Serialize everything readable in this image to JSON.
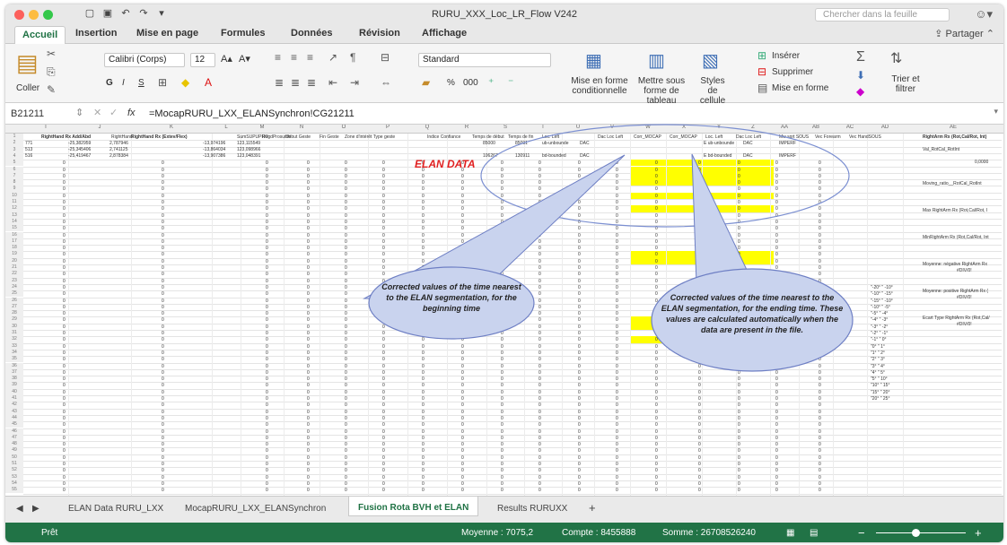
{
  "window": {
    "title": "RURU_XXX_Loc_LR_Flow V242",
    "search_placeholder": "Chercher dans la feuille"
  },
  "ribbon_tabs": [
    "Accueil",
    "Insertion",
    "Mise en page",
    "Formules",
    "Données",
    "Révision",
    "Affichage"
  ],
  "share_label": "Partager",
  "ribbon": {
    "paste_label": "Coller",
    "font_name": "Calibri (Corps)",
    "font_size": "12",
    "number_format": "Standard",
    "bold": "G",
    "italic": "I",
    "underline": "S",
    "percent": "%",
    "thousands": "000",
    "cond_format": "Mise en forme conditionnelle",
    "table_format": "Mettre sous forme de tableau",
    "cell_styles": "Styles de cellule",
    "insert": "Insérer",
    "delete": "Supprimer",
    "format": "Mise en forme",
    "sort_filter": "Trier et filtrer"
  },
  "formula_bar": {
    "cell_ref": "B21211",
    "fx": "fx",
    "formula": "=MocapRURU_LXX_ELANSynchron!CG21211"
  },
  "columns": [
    "I",
    "J",
    "K",
    "L",
    "M",
    "N",
    "O",
    "P",
    "Q",
    "R",
    "S",
    "T",
    "U",
    "V",
    "W",
    "X",
    "Y",
    "Z",
    "AA",
    "AB",
    "AC",
    "AD",
    "AE"
  ],
  "headers": {
    "c1": "RightHand Rx Add/Abd",
    "c2": "RightHand",
    "c3": "RightHand Rx (Extev/Flex)",
    "c4": "SumSUPUPRO",
    "c5": "RegdProsumb",
    "c6": "Début Geste",
    "c7": "Fin Geste",
    "c8": "Zone d'intérêt Type geste",
    "c9": "Indice Confiance",
    "c10": "Temps de début",
    "c11": "Temps de fin",
    "c12": "Loc. Left",
    "c13": "Dac Loc Left",
    "c14": "Corr_MOCAP",
    "c15": "Corr_MOCAP",
    "c16": "Loc. Left",
    "c17": "Dac Loc Left",
    "c18": "Mw sqrt SOUS",
    "c19": "Vec Forearm",
    "c20": "Vec HandSOUS",
    "c21": "RightArm Rx (Rot,Cal/Rot, Int)"
  },
  "rows": [
    [
      "771",
      "-25,382959",
      "2,787946",
      "-13,974196",
      "123,115549"
    ],
    [
      "513",
      "-25,345406",
      "2,741125",
      "-13,864034",
      "123,098966"
    ],
    [
      "516",
      "-25,419467",
      "2,878384",
      "-13,907386",
      "123,048391"
    ]
  ],
  "elan_values": [
    "85000",
    "85091",
    "ub-unbounde",
    "DAC",
    "E ub-unbounde",
    "DAC",
    "IMPERF"
  ],
  "elan_values2": [
    "106267",
    "130911",
    "bd-bounded",
    "DAC",
    "E bd-bounded",
    "DAC",
    "IMPERF"
  ],
  "side_labels": [
    "Val_RotCal_RotInt",
    "0,0000",
    "Moving_ratio__RotCal_RotInt",
    "Max RightArm Rx (Rot,Cal/Rot, I",
    "MinRightArm Rx (Rot,Cal/Rot, Int",
    "Moyenne: négative RightArm Rx",
    "#DIV/0!",
    "Moyenne: positive RightArm Rx (",
    "#DIV/0!",
    "Ecart Type RightArm Rx (Rot,Cal/",
    "#DIV/0!"
  ],
  "angle_list": [
    "\"-20° \" -10°",
    "\"-10° \" -15°",
    "\"-15° \" -10°",
    "\"-10° \" -5°",
    "\"-5° \" -4°",
    "\"-4° \" -3°",
    "\"-3° \" -2°",
    "\"-2° \" -1°",
    "\"-1° \" 0°",
    "\"0° \" 1°",
    "\"1° \" 2°",
    "\"2° \" 3°",
    "\"3° \" 4°",
    "\"4° \" 5°",
    "\"5° \" 10°",
    "\"10° \" 15°",
    "\"15° \" 20°",
    "\"20° \" 25°"
  ],
  "annotations": {
    "elan_data": "ELAN DATA",
    "left_bubble": "Corrected values of the time nearest to the ELAN segmentation, for the  beginning time",
    "right_bubble": "Corrected values of the time nearest to the ELAN segmentation, for the  ending time. These values are calculated automatically when the data are present in the file."
  },
  "sheet_tabs": [
    "ELAN Data RURU_LXX",
    "MocapRURU_LXX_ELANSynchron",
    "Fusion Rota BVH et ELAN",
    "Results RURUXX"
  ],
  "active_sheet": "Fusion Rota BVH et ELAN",
  "add_sheet": "+",
  "status": {
    "ready": "Prêt",
    "average": "Moyenne : 7075,2",
    "count": "Compte : 8455888",
    "sum": "Somme : 26708526240"
  },
  "colors": {
    "excel_green": "#217346",
    "highlight": "#ffff00",
    "elan_red": "#e02020",
    "bubble_fill": "#c9d3ee"
  }
}
